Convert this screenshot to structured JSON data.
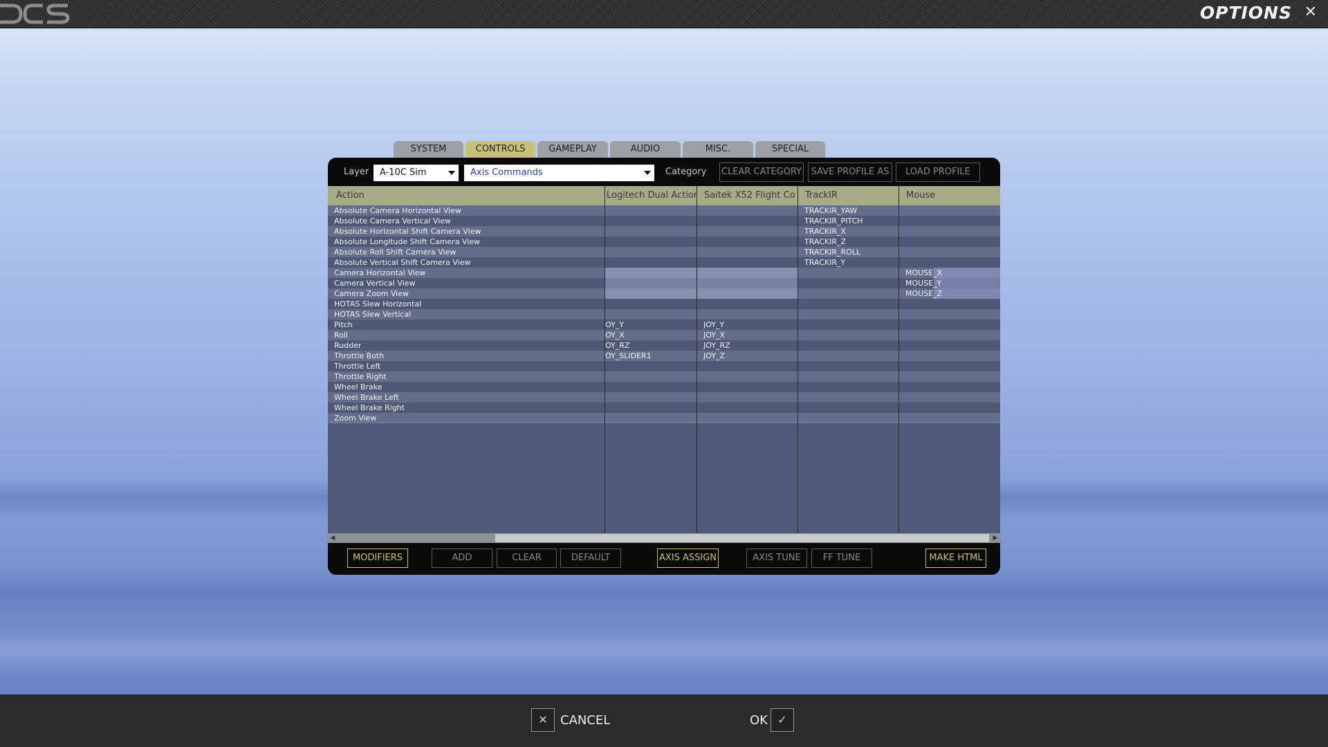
{
  "window": {
    "title": "OPTIONS",
    "close_symbol": "✕"
  },
  "tabs": [
    {
      "label": "SYSTEM",
      "active": false
    },
    {
      "label": "CONTROLS",
      "active": true
    },
    {
      "label": "GAMEPLAY",
      "active": false
    },
    {
      "label": "AUDIO",
      "active": false
    },
    {
      "label": "MISC.",
      "active": false
    },
    {
      "label": "SPECIAL",
      "active": false
    }
  ],
  "toolbar": {
    "layer_label": "Layer",
    "layer_value": "A-10C Sim",
    "category_value": "Axis Commands",
    "category_label": "Category",
    "clear_category": "CLEAR CATEGORY",
    "save_profile": "SAVE PROFILE AS",
    "load_profile": "LOAD PROFILE"
  },
  "table": {
    "columns": [
      "Action",
      "Logitech Dual Action",
      "Saitek X52 Flight Co",
      "TrackIR",
      "Mouse"
    ],
    "rows": [
      {
        "action": "Absolute Camera Horizontal View",
        "logitech": "",
        "saitek": "",
        "trackir": "TRACKIR_YAW",
        "mouse": ""
      },
      {
        "action": "Absolute Camera Vertical View",
        "logitech": "",
        "saitek": "",
        "trackir": "TRACKIR_PITCH",
        "mouse": ""
      },
      {
        "action": "Absolute Horizontal Shift Camera View",
        "logitech": "",
        "saitek": "",
        "trackir": "TRACKIR_X",
        "mouse": ""
      },
      {
        "action": "Absolute Longitude Shift Camera View",
        "logitech": "",
        "saitek": "",
        "trackir": "TRACKIR_Z",
        "mouse": ""
      },
      {
        "action": "Absolute Roll Shift Camera View",
        "logitech": "",
        "saitek": "",
        "trackir": "TRACKIR_ROLL",
        "mouse": ""
      },
      {
        "action": "Absolute Vertical Shift Camera View",
        "logitech": "",
        "saitek": "",
        "trackir": "TRACKIR_Y",
        "mouse": ""
      },
      {
        "action": "Camera Horizontal View",
        "logitech": "",
        "saitek": "",
        "trackir": "",
        "mouse": "MOUSE_X"
      },
      {
        "action": "Camera Vertical View",
        "logitech": "",
        "saitek": "",
        "trackir": "",
        "mouse": "MOUSE_Y"
      },
      {
        "action": "Camera Zoom View",
        "logitech": "",
        "saitek": "",
        "trackir": "",
        "mouse": "MOUSE_Z"
      },
      {
        "action": "HOTAS Slew Horizontal",
        "logitech": "",
        "saitek": "",
        "trackir": "",
        "mouse": ""
      },
      {
        "action": "HOTAS Slew Vertical",
        "logitech": "",
        "saitek": "",
        "trackir": "",
        "mouse": ""
      },
      {
        "action": "Pitch",
        "logitech": "OY_Y",
        "saitek": "JOY_Y",
        "trackir": "",
        "mouse": ""
      },
      {
        "action": "Roll",
        "logitech": "OY_X",
        "saitek": "JOY_X",
        "trackir": "",
        "mouse": ""
      },
      {
        "action": "Rudder",
        "logitech": "OY_RZ",
        "saitek": "JOY_RZ",
        "trackir": "",
        "mouse": ""
      },
      {
        "action": "Throttle Both",
        "logitech": "OY_SLIDER1",
        "saitek": "JOY_Z",
        "trackir": "",
        "mouse": ""
      },
      {
        "action": "Throttle Left",
        "logitech": "",
        "saitek": "",
        "trackir": "",
        "mouse": ""
      },
      {
        "action": "Throttle Right",
        "logitech": "",
        "saitek": "",
        "trackir": "",
        "mouse": ""
      },
      {
        "action": "Wheel Brake",
        "logitech": "",
        "saitek": "",
        "trackir": "",
        "mouse": ""
      },
      {
        "action": "Wheel Brake Left",
        "logitech": "",
        "saitek": "",
        "trackir": "",
        "mouse": ""
      },
      {
        "action": "Wheel Brake Right",
        "logitech": "",
        "saitek": "",
        "trackir": "",
        "mouse": ""
      },
      {
        "action": "Zoom View",
        "logitech": "",
        "saitek": "",
        "trackir": "",
        "mouse": ""
      }
    ]
  },
  "actions": {
    "modifiers": "MODIFIERS",
    "add": "ADD",
    "clear": "CLEAR",
    "default": "DEFAULT",
    "axis_assign": "AXIS ASSIGN",
    "axis_tune": "AXIS TUNE",
    "ff_tune": "FF TUNE",
    "make_html": "MAKE HTML"
  },
  "footer": {
    "cancel_label": "CANCEL",
    "cancel_symbol": "✕",
    "ok_label": "OK",
    "ok_symbol": "✓"
  },
  "colors": {
    "accent": "#c8c178",
    "header_bg": "#a7aa87"
  }
}
